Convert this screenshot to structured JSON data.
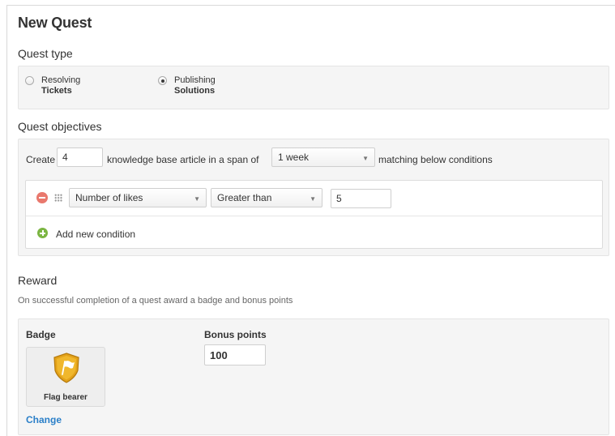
{
  "page": {
    "title": "New Quest"
  },
  "quest_type": {
    "label": "Quest type",
    "options": [
      {
        "line1": "Resolving",
        "line2": "Tickets",
        "selected": false
      },
      {
        "line1": "Publishing",
        "line2": "Solutions",
        "selected": true
      }
    ]
  },
  "objectives": {
    "label": "Quest objectives",
    "create_label": "Create",
    "count": "4",
    "mid_text": "knowledge base article in a span of",
    "span": "1 week",
    "end_text": "matching below conditions",
    "condition": {
      "field": "Number of likes",
      "operator": "Greater than",
      "value": "5"
    },
    "add_condition": "Add new condition"
  },
  "reward": {
    "label": "Reward",
    "description": "On successful completion of a quest award a badge and bonus points",
    "badge_label": "Badge",
    "badge_name": "Flag bearer",
    "change_link": "Change",
    "bonus_label": "Bonus points",
    "bonus_value": "100"
  },
  "colors": {
    "link": "#2a7fc8",
    "badge_gold": "#e3a21a",
    "remove": "#e9786d",
    "add": "#7bb542"
  },
  "icons": [
    "remove-condition-icon",
    "drag-handle-icon",
    "add-condition-icon",
    "flag-badge-icon",
    "caret-down-icon"
  ]
}
